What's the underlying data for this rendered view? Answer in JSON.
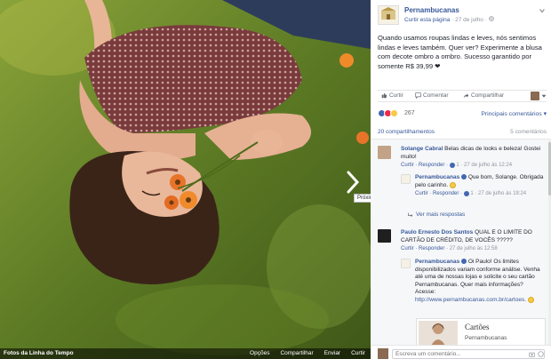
{
  "photo": {
    "next_tooltip": "Próxima",
    "footer": {
      "album": "Fotos da Linha do Tempo",
      "actions": [
        "Opções",
        "Compartilhar",
        "Enviar",
        "Curtir"
      ]
    }
  },
  "post": {
    "page_name": "Pernambucanas",
    "page_like": "Curtir esta página",
    "date": "27 de julho",
    "text": "Quando usamos roupas lindas e leves, nós sentimos lindas e leves também. Quer ver? Experimente a blusa com decote ombro a ombro. Sucesso garantido por somente R$ 39,99 ❤",
    "actions": {
      "like": "Curtir",
      "comment": "Comentar",
      "share": "Compartilhar"
    },
    "reactions_count": "267",
    "main_comments": "Principais comentários",
    "shares": "20 compartilhamentos",
    "comments_count": "5 comentários"
  },
  "comments": [
    {
      "author": "Solange Cabral",
      "text": "Belas dicas de looks e beleza! Gostei muito!",
      "reply": "Curtir · Responder ·",
      "likes": "1",
      "time": "· 27 de julho às 12:24"
    },
    {
      "author": "Pernambucanas",
      "text": "Que bom, Solange. Obrigada pelo carinho.",
      "reply": "Curtir · Responder ·",
      "likes": "1",
      "time": "· 27 de julho às 19:24"
    },
    {
      "author": "Paulo Ernesto Dos Santos",
      "text": "QUAL E O LIMITE DO CARTÃO DE CRÉDITO, DE VOCÊS ?????",
      "reply": "Curtir · Responder ·",
      "time": "27 de julho às 12:58"
    },
    {
      "author": "Pernambucanas",
      "text": "Oi Paulo! Os limites disponibilizados variam conforme análise. Venha até uma de nossas lojas e solicite o seu cartão Pernambucanas. Quer mais informações? Acesse:",
      "url": "http://www.pernambucanas.com.br/cartoes."
    }
  ],
  "see_replies": "Ver mais respostas",
  "link_card": {
    "title": "Cartões",
    "subtitle": "Pernambucanas"
  },
  "write_placeholder": "Escreva um comentário...",
  "colors": {
    "link": "#365899",
    "like_blue": "#4267b2",
    "love_red": "#f0284a",
    "wow_yellow": "#f7c948",
    "grass": "#5f7a26"
  }
}
